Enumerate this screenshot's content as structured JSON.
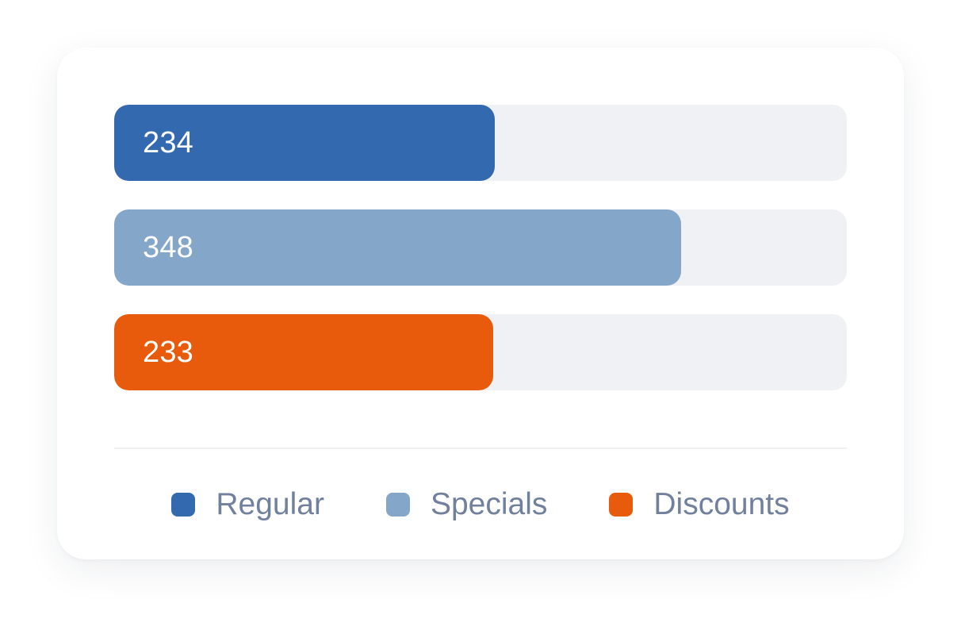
{
  "chart_data": {
    "type": "bar",
    "orientation": "horizontal",
    "categories": [
      "Regular",
      "Specials",
      "Discounts"
    ],
    "values": [
      234,
      348,
      233
    ],
    "data_labels": [
      "234",
      "348",
      "233"
    ],
    "colors": [
      "#336aaf",
      "#84a6c8",
      "#e95b0c"
    ],
    "track_color": "#f0f1f5",
    "legend": {
      "position": "bottom",
      "items": [
        {
          "label": "Regular",
          "color": "#336aaf"
        },
        {
          "label": "Specials",
          "color": "#84a6c8"
        },
        {
          "label": "Discounts",
          "color": "#e95b0c"
        }
      ]
    },
    "grid": false
  }
}
